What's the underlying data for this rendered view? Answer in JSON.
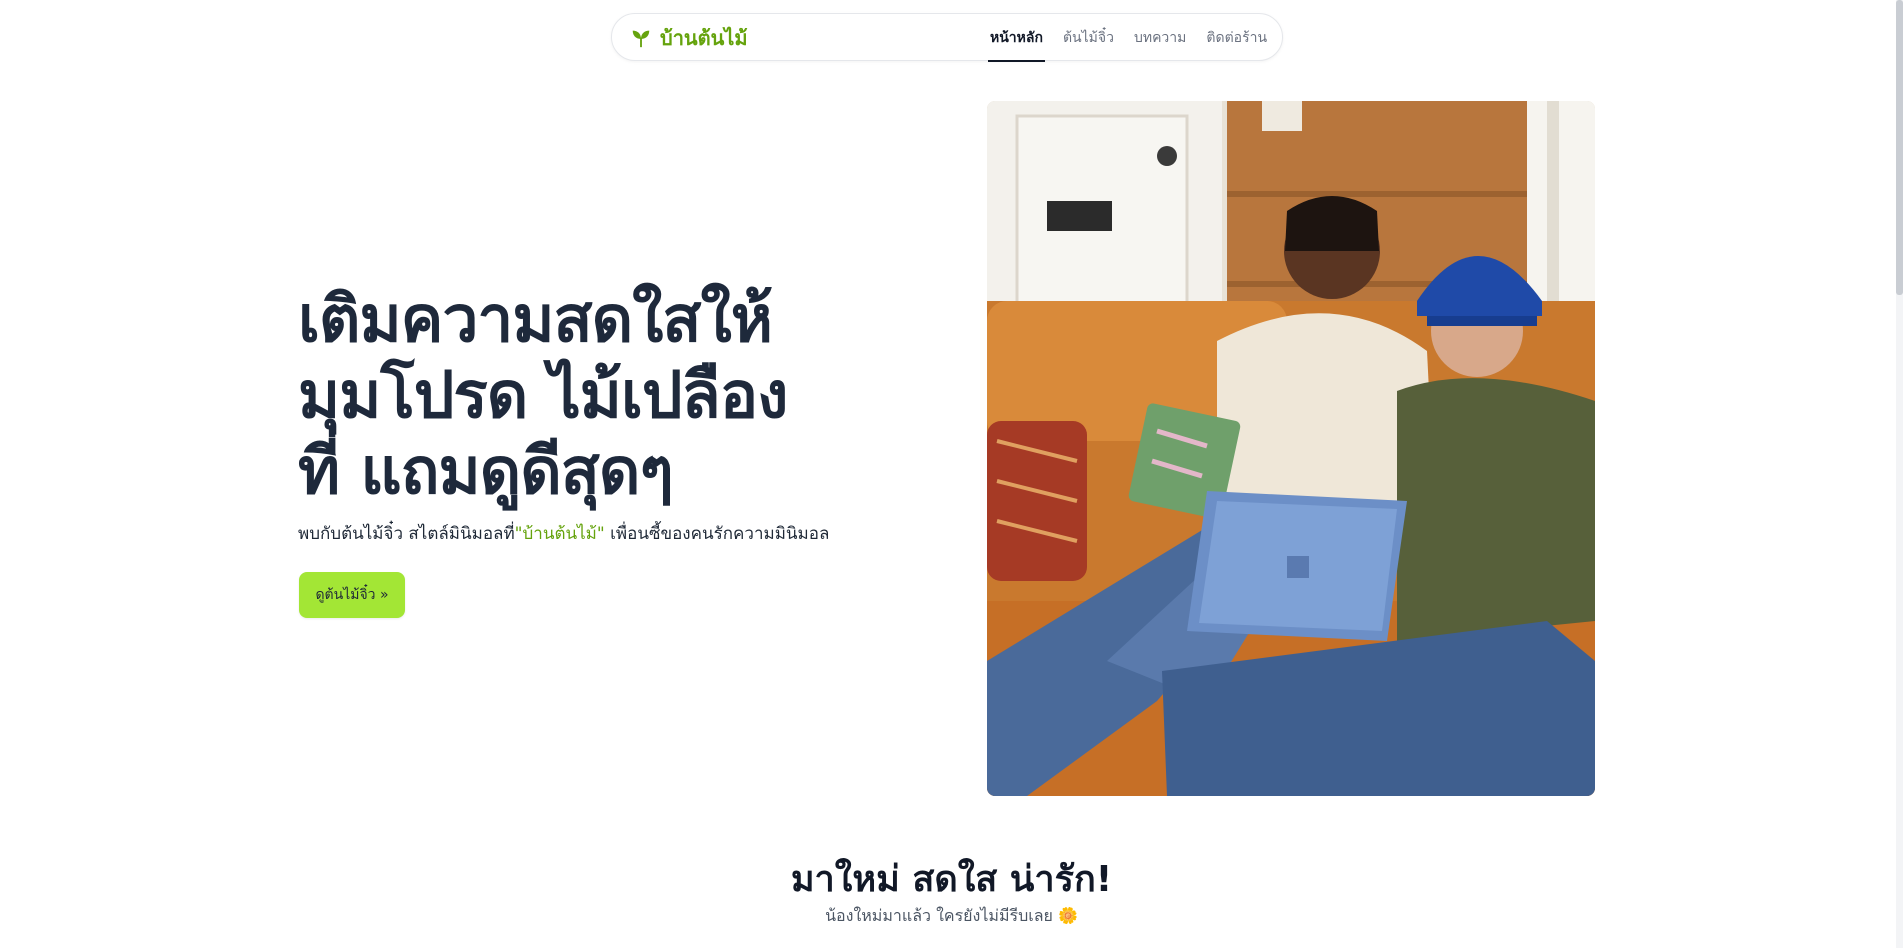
{
  "nav": {
    "brand": "บ้านต้นไม้",
    "brand_icon": "leaf-icon",
    "links": [
      {
        "label": "หน้าหลัก",
        "active": true
      },
      {
        "label": "ต้นไม้จิ๋ว",
        "active": false
      },
      {
        "label": "บทความ",
        "active": false
      },
      {
        "label": "ติดต่อร้าน",
        "active": false
      }
    ]
  },
  "hero": {
    "title_lines": [
      "เติมความสดใสให้",
      "มุมโปรด ไม้เปลือง",
      "ที่ แถมดูดีสุดๆ"
    ],
    "subtitle_before": "พบกับต้นไม้จิ๋ว สไตล์มินิมอลที่",
    "subtitle_accent": "\"บ้านต้นไม้\"",
    "subtitle_after": " เพื่อนซี้ของคนรักความมินิมอล",
    "cta_label": "ดูต้นไม้จิ๋ว »"
  },
  "section": {
    "title": "มาใหม่ สดใส น่ารัก!",
    "subtitle": "น้องใหม่มาแล้ว ใครยังไม่มีรีบเลย 🌼"
  },
  "colors": {
    "brand_green": "#65a30d",
    "cta_lime": "#a3e635",
    "heading_navy": "#1e293b"
  }
}
